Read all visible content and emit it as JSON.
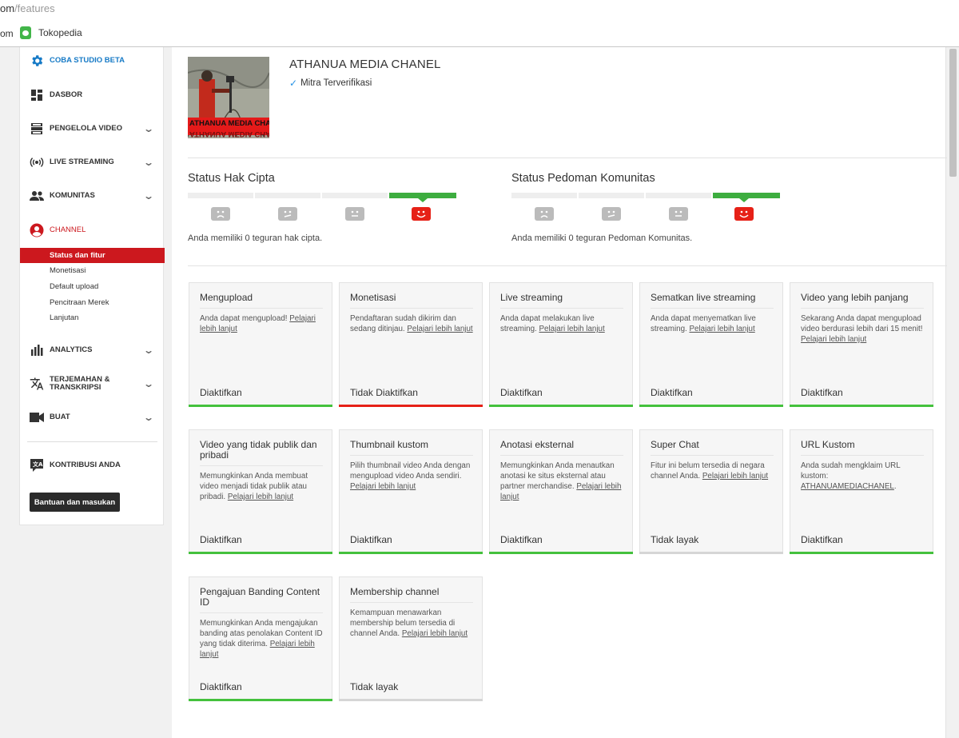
{
  "browser": {
    "url_host": "om",
    "url_path": "/features",
    "bookmark_prev": "om",
    "bookmark": "Tokopedia"
  },
  "sidebar": {
    "studio_beta": "COBA STUDIO BETA",
    "dasbor": "DASBOR",
    "pengelola_video": "PENGELOLA VIDEO",
    "live_streaming": "LIVE STREAMING",
    "komunitas": "KOMUNITAS",
    "channel": "CHANNEL",
    "channel_sub": [
      "Status dan fitur",
      "Monetisasi",
      "Default upload",
      "Pencitraan Merek",
      "Lanjutan"
    ],
    "analytics": "ANALYTICS",
    "terjemahan_line1": "TERJEMAHAN &",
    "terjemahan_line2": "TRANSKRIPSI",
    "buat": "BUAT",
    "kontribusi": "KONTRIBUSI ANDA",
    "help_button": "Bantuan dan masukan"
  },
  "channel": {
    "name": "ATHANUA MEDIA CHANEL",
    "thumbnail_text": "ATHANUA MEDIA CHANEL",
    "verified": "Mitra Terverifikasi"
  },
  "copyright_status": {
    "title": "Status Hak Cipta",
    "text": "Anda memiliki 0 teguran hak cipta.",
    "level_index": 3
  },
  "community_status": {
    "title": "Status Pedoman Komunitas",
    "text": "Anda memiliki 0 teguran Pedoman Komunitas.",
    "level_index": 3
  },
  "link_text": "Pelajari lebih lanjut",
  "cards": [
    {
      "title": "Mengupload",
      "desc": "Anda dapat mengupload!",
      "link": "Pelajari lebih lanjut",
      "status": "Diaktifkan",
      "bar": "green"
    },
    {
      "title": "Monetisasi",
      "desc": "Pendaftaran sudah dikirim dan sedang ditinjau.",
      "link": "Pelajari lebih lanjut",
      "status": "Tidak Diaktifkan",
      "bar": "red"
    },
    {
      "title": "Live streaming",
      "desc": "Anda dapat melakukan live streaming.",
      "link": "Pelajari lebih lanjut",
      "status": "Diaktifkan",
      "bar": "green"
    },
    {
      "title": "Sematkan live streaming",
      "desc": "Anda dapat menyematkan live streaming.",
      "link": "Pelajari lebih lanjut",
      "status": "Diaktifkan",
      "bar": "green"
    },
    {
      "title": "Video yang lebih panjang",
      "desc": "Sekarang Anda dapat mengupload video berdurasi lebih dari 15 menit!",
      "link": "Pelajari lebih lanjut",
      "status": "Diaktifkan",
      "bar": "green"
    },
    {
      "title": "Video yang tidak publik dan pribadi",
      "desc": "Memungkinkan Anda membuat video menjadi tidak publik atau pribadi.",
      "link": "Pelajari lebih lanjut",
      "status": "Diaktifkan",
      "bar": "green"
    },
    {
      "title": "Thumbnail kustom",
      "desc": "Pilih thumbnail video Anda dengan mengupload video Anda sendiri.",
      "link": "Pelajari lebih lanjut",
      "status": "Diaktifkan",
      "bar": "green"
    },
    {
      "title": "Anotasi eksternal",
      "desc": "Memungkinkan Anda menautkan anotasi ke situs eksternal atau partner merchandise.",
      "link": "Pelajari lebih lanjut",
      "status": "Diaktifkan",
      "bar": "green"
    },
    {
      "title": "Super Chat",
      "desc": "Fitur ini belum tersedia di negara channel Anda.",
      "link": "Pelajari lebih lanjut",
      "status": "Tidak layak",
      "bar": "gray"
    },
    {
      "title": "URL Kustom",
      "desc": "Anda sudah mengklaim URL kustom:",
      "link": "ATHANUAMEDIACHANEL",
      "suffix": ".",
      "status": "Diaktifkan",
      "bar": "green"
    },
    {
      "title": "Pengajuan Banding Content ID",
      "desc": "Memungkinkan Anda mengajukan banding atas penolakan Content ID yang tidak diterima.",
      "link": "Pelajari lebih lanjut",
      "status": "Diaktifkan",
      "bar": "green"
    },
    {
      "title": "Membership channel",
      "desc": "Kemampuan menawarkan membership belum tersedia di channel Anda.",
      "link": "Pelajari lebih lanjut",
      "status": "Tidak layak",
      "bar": "gray"
    }
  ]
}
